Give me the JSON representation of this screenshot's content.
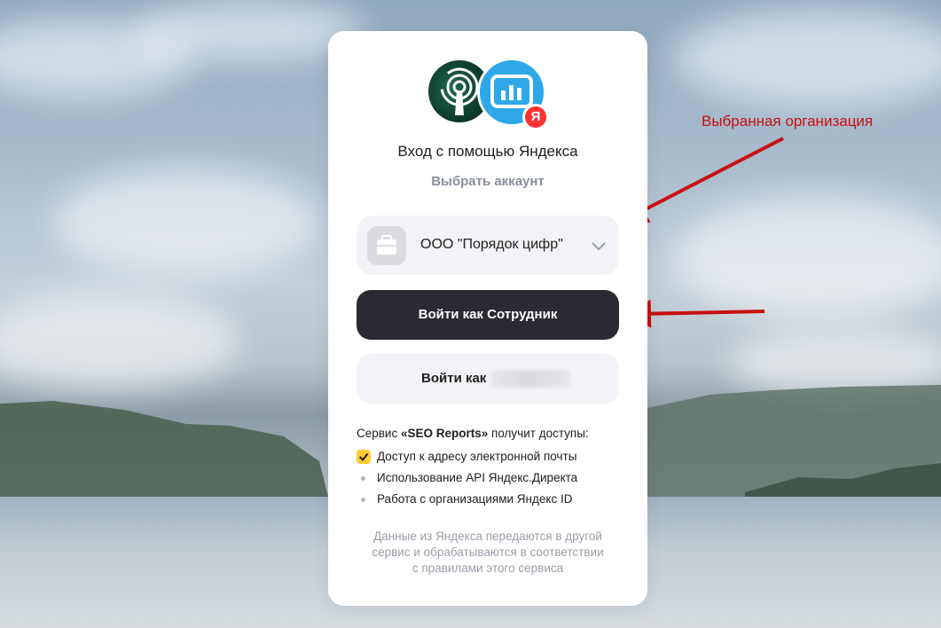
{
  "auth": {
    "title": "Вход с помощью Яндекса",
    "choose_account": "Выбрать аккаунт",
    "badge": "Я"
  },
  "org_select": {
    "selected": "ООО \"Порядок цифр\""
  },
  "buttons": {
    "primary": "Войти как Сотрудник",
    "secondary": "Войти как"
  },
  "service": {
    "prefix": "Сервис ",
    "name": "«SEO Reports»",
    "suffix": " получит доступы:"
  },
  "permissions": [
    {
      "label": "Доступ к адресу электронной почты",
      "checked": true
    },
    {
      "label": "Использование API Яндекс.Директа",
      "checked": false
    },
    {
      "label": "Работа с организациями Яндекс ID",
      "checked": false
    }
  ],
  "footer": {
    "line1": "Данные из Яндекса передаются в другой",
    "line2": "сервис и обрабатываются в соответствии",
    "line3": "с правилами этого сервиса"
  },
  "annotation": {
    "text": "Выбранная организация",
    "color": "#c81010"
  },
  "colors": {
    "primary_button": "#2b2a33",
    "checkbox": "#ffcc33",
    "yandex_red": "#ff3333"
  }
}
